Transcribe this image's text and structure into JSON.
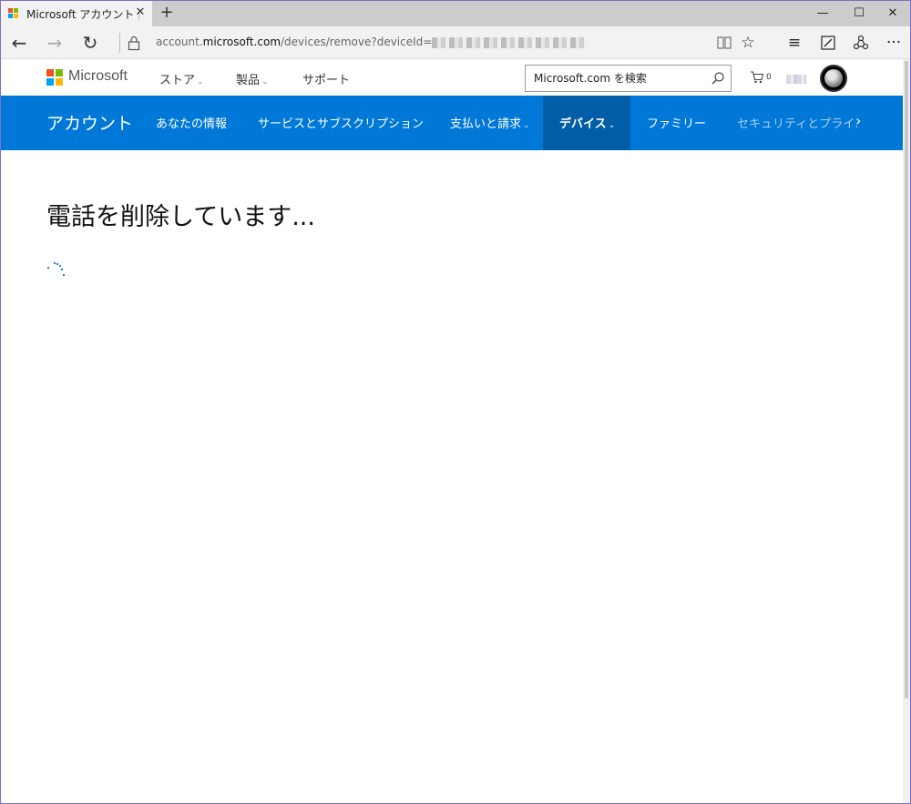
{
  "browser": {
    "tab_title": "Microsoft アカウント | デバ",
    "url_prefix": "account.",
    "url_domain": "microsoft.com",
    "url_path": "/devices/remove?deviceId="
  },
  "site_header": {
    "brand": "Microsoft",
    "nav": [
      {
        "label": "ストア",
        "has_dropdown": true
      },
      {
        "label": "製品",
        "has_dropdown": true
      },
      {
        "label": "サポート",
        "has_dropdown": false
      }
    ],
    "search_placeholder": "Microsoft.com を検索",
    "cart_count": "0"
  },
  "account_nav": {
    "title": "アカウント",
    "items": [
      {
        "label": "あなたの情報"
      },
      {
        "label": "サービスとサブスクリプション"
      },
      {
        "label": "支払いと請求"
      },
      {
        "label": "デバイス"
      },
      {
        "label": "ファミリー"
      },
      {
        "label": "セキュリティとプライ."
      }
    ]
  },
  "main": {
    "heading": "電話を削除しています..."
  },
  "colors": {
    "accent": "#0078d7",
    "accent_active": "#005da6",
    "logo_red": "#f25022",
    "logo_green": "#7fba00",
    "logo_blue": "#00a4ef",
    "logo_yellow": "#ffb900"
  }
}
